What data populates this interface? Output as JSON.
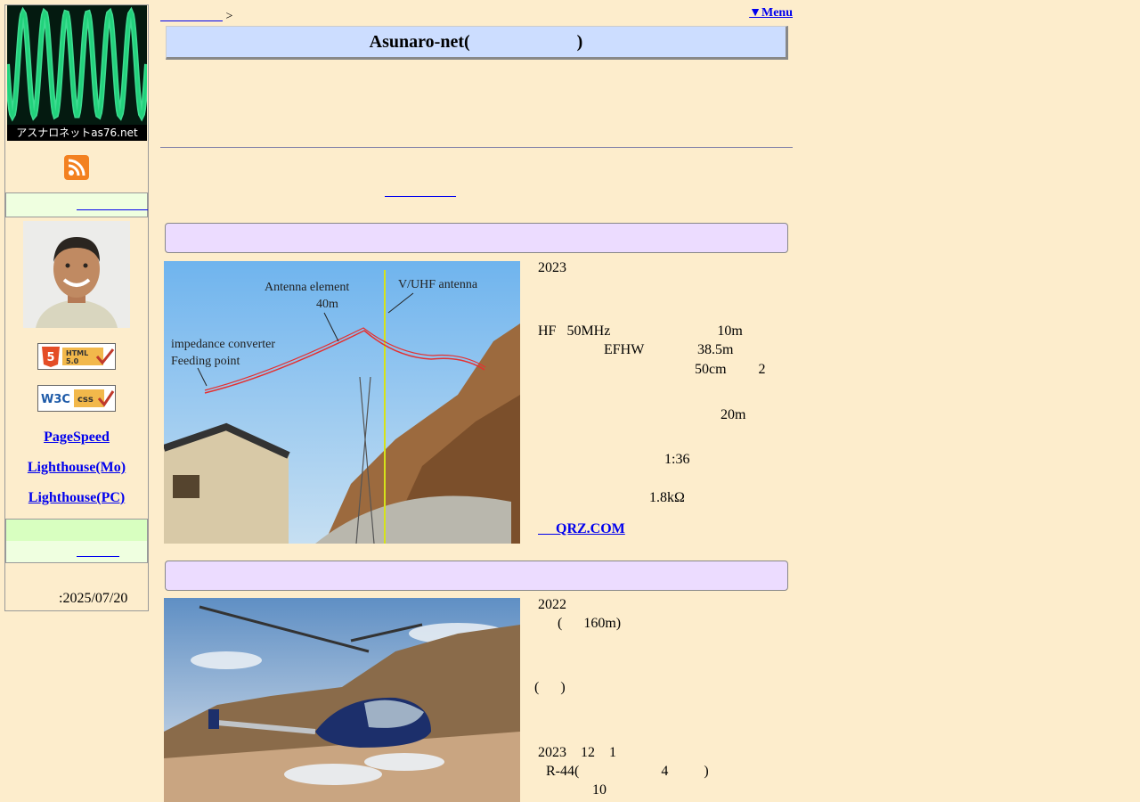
{
  "sidebar": {
    "logo_caption": "アスナロネットas76.net",
    "link_top": "　　　　　",
    "links": [
      "PageSpeed",
      "Lighthouse(Mo)",
      "Lighthouse(PC)"
    ],
    "link_bottom": "　　　",
    "badges": {
      "html": "HTML 5.0",
      "css": "W3C CSS"
    },
    "updated": ":2025/07/20"
  },
  "header": {
    "breadcrumb_link": "　　　　　",
    "breadcrumb_sep": " >",
    "menu_label": "▼Menu",
    "title": "Asunaro-net(　　　　　　)"
  },
  "main": {
    "center_link": "　　　　　",
    "section1": {
      "image_labels": {
        "element": "Antenna element",
        "element_len": "40m",
        "vuhf": "V/UHF antenna",
        "imp": "impedance converter",
        "feed": "Feeding point"
      },
      "lines": [
        "2023",
        "HF   50MHz                              10m",
        "EFHW               38.5m",
        "50cm         2",
        "20m",
        "1:36",
        "1.8kΩ"
      ],
      "qrz": "　 QRZ.COM"
    },
    "section2": {
      "lines": [
        "2022",
        "(      160m)",
        "(      )",
        "2023    12    1",
        "R-44(                       4          )",
        "10"
      ]
    }
  }
}
